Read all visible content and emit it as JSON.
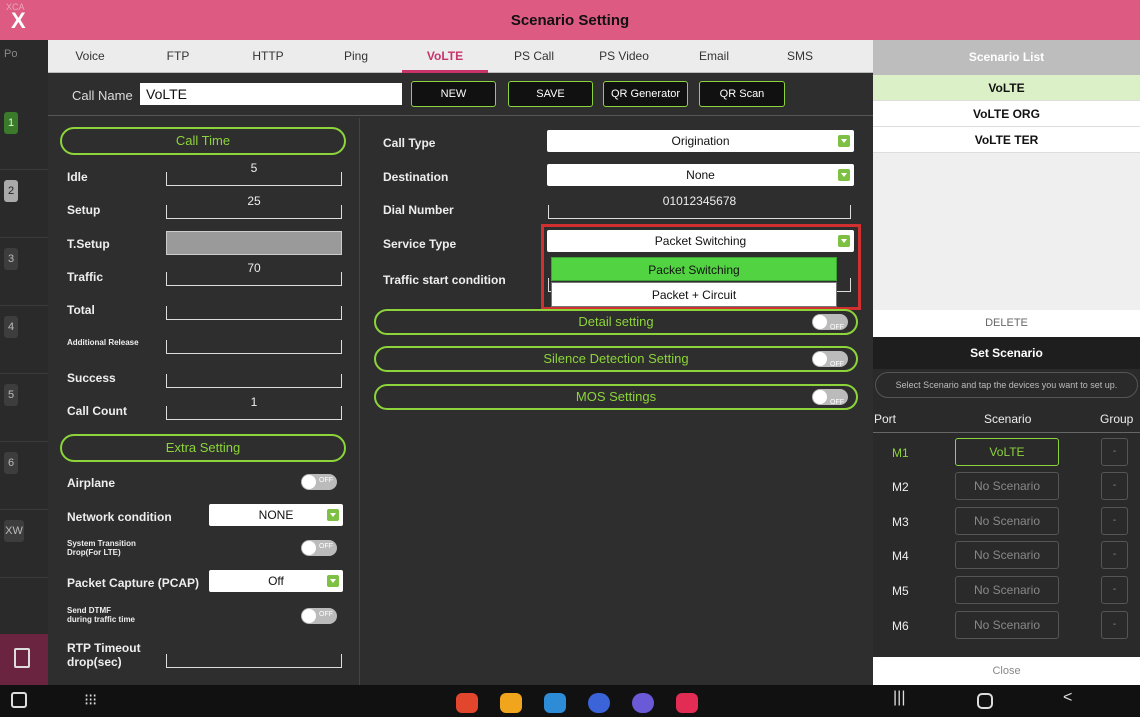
{
  "title": "Scenario Setting",
  "close_label": "X",
  "background_app": {
    "header_text": "XCA",
    "sub_text": "Po",
    "rows": [
      "1",
      "2",
      "3",
      "4",
      "5",
      "6",
      "XW"
    ]
  },
  "tabs": [
    {
      "label": "Voice"
    },
    {
      "label": "FTP"
    },
    {
      "label": "HTTP"
    },
    {
      "label": "Ping"
    },
    {
      "label": "VoLTE",
      "active": true
    },
    {
      "label": "PS Call"
    },
    {
      "label": "PS Video"
    },
    {
      "label": "Email"
    },
    {
      "label": "SMS"
    }
  ],
  "call_name": {
    "label": "Call Name",
    "value": "VoLTE"
  },
  "buttons": {
    "new": "NEW",
    "save": "SAVE",
    "qr_generator": "QR Generator",
    "qr_scan": "QR Scan"
  },
  "call_time": {
    "title": "Call Time",
    "fields": [
      {
        "label": "Idle",
        "value": "5"
      },
      {
        "label": "Setup",
        "value": "25"
      },
      {
        "label": "T.Setup",
        "value": ""
      },
      {
        "label": "Traffic",
        "value": "70"
      },
      {
        "label": "Total",
        "value": ""
      },
      {
        "label": "Additional Release",
        "value": ""
      },
      {
        "label": "Success",
        "value": ""
      },
      {
        "label": "Call Count",
        "value": "1"
      }
    ]
  },
  "extra_setting": {
    "title": "Extra Setting",
    "airplane": "Airplane",
    "network_condition": {
      "label": "Network condition",
      "value": "NONE"
    },
    "system_transition": "System Transition\nDrop(For LTE)",
    "packet_capture": {
      "label": "Packet Capture (PCAP)",
      "value": "Off"
    },
    "send_dtmf": "Send DTMF\nduring traffic time",
    "rtp_timeout": "RTP Timeout\ndrop(sec)",
    "toggle_off": "OFF"
  },
  "call_settings": {
    "call_type": {
      "label": "Call Type",
      "value": "Origination"
    },
    "destination": {
      "label": "Destination",
      "value": "None"
    },
    "dial_number": {
      "label": "Dial Number",
      "value": "01012345678"
    },
    "service_type": {
      "label": "Service Type",
      "value": "Packet Switching"
    },
    "traffic_start": {
      "label": "Traffic start condition"
    },
    "dropdown_options": [
      "Packet Switching",
      "Packet + Circuit"
    ]
  },
  "sections": {
    "detail": "Detail setting",
    "silence": "Silence Detection Setting",
    "mos": "MOS Settings"
  },
  "scenario_list": {
    "title": "Scenario List",
    "items": [
      "VoLTE",
      "VoLTE ORG",
      "VoLTE TER"
    ],
    "delete": "DELETE"
  },
  "set_scenario": {
    "title": "Set Scenario",
    "hint": "Select Scenario and tap the devices you want to set up.",
    "headers": {
      "port": "Port",
      "scenario": "Scenario",
      "group": "Group"
    },
    "rows": [
      {
        "port": "M1",
        "scenario": "VoLTE",
        "group": "-"
      },
      {
        "port": "M2",
        "scenario": "No Scenario",
        "group": "-"
      },
      {
        "port": "M3",
        "scenario": "No Scenario",
        "group": "-"
      },
      {
        "port": "M4",
        "scenario": "No Scenario",
        "group": "-"
      },
      {
        "port": "M5",
        "scenario": "No Scenario",
        "group": "-"
      },
      {
        "port": "M6",
        "scenario": "No Scenario",
        "group": "-"
      }
    ],
    "close": "Close"
  },
  "colors": {
    "accent_green": "#8cd43a",
    "title_pink": "#dd5a82",
    "tab_active": "#c8336a",
    "highlight_red": "#d03030"
  }
}
